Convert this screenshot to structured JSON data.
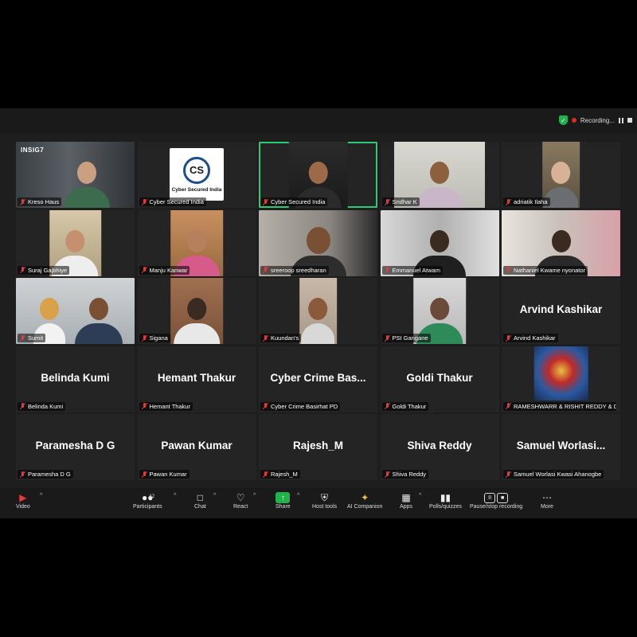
{
  "status": {
    "recording_label": "Recording..."
  },
  "tiles": [
    {
      "name": "Kreso Haus",
      "big": ""
    },
    {
      "name": "Cyber Secured India",
      "big": "",
      "logo_text": "Cyber Secured India",
      "logo_mark": "CS"
    },
    {
      "name": "Cyber Secured India",
      "big": ""
    },
    {
      "name": "Sridhar K",
      "big": ""
    },
    {
      "name": "adriatik Ilaha",
      "big": ""
    },
    {
      "name": "Suraj Gajbhiye",
      "big": ""
    },
    {
      "name": "Manju Kanwar",
      "big": ""
    },
    {
      "name": "sreeroop sreedharan",
      "big": ""
    },
    {
      "name": "Emmanuel Atwam",
      "big": ""
    },
    {
      "name": "Nathaniel Kwame nyonator",
      "big": ""
    },
    {
      "name": "Sumit",
      "big": ""
    },
    {
      "name": "Sigana",
      "big": ""
    },
    {
      "name": "Kuundan's",
      "big": ""
    },
    {
      "name": "PSI Gangane",
      "big": ""
    },
    {
      "name": "Arvind Kashikar",
      "big": "Arvind Kashikar"
    },
    {
      "name": "Belinda Kumi",
      "big": "Belinda Kumi"
    },
    {
      "name": "Hemant Thakur",
      "big": "Hemant Thakur"
    },
    {
      "name": "Cyber Crime Basirhat PD",
      "big": "Cyber Crime Bas..."
    },
    {
      "name": "Goldi Thakur",
      "big": "Goldi Thakur"
    },
    {
      "name": "RAMESHWARR & RISHIT REDDY & DEV...",
      "big": ""
    },
    {
      "name": "Paramesha D G",
      "big": "Paramesha D G"
    },
    {
      "name": "Pawan Kumar",
      "big": "Pawan Kumar"
    },
    {
      "name": "Rajesh_M",
      "big": "Rajesh_M"
    },
    {
      "name": "Shiva Reddy",
      "big": "Shiva Reddy"
    },
    {
      "name": "Samuel Worlasi Kwasi Ahanogbe",
      "big": "Samuel  Worlasi..."
    }
  ],
  "logo_insig": "INSIG7",
  "toolbar": {
    "video": "Video",
    "participants": "Participants",
    "participants_count": "42",
    "chat": "Chat",
    "react": "React",
    "share": "Share",
    "host_tools": "Host tools",
    "ai_companion": "AI Companion",
    "apps": "Apps",
    "polls": "Polls/quizzes",
    "recording": "Pause/stop recording",
    "more": "More"
  },
  "colors": {
    "active_speaker": "#2ecc71",
    "share": "#22b14c",
    "muted": "#e43b3b"
  }
}
